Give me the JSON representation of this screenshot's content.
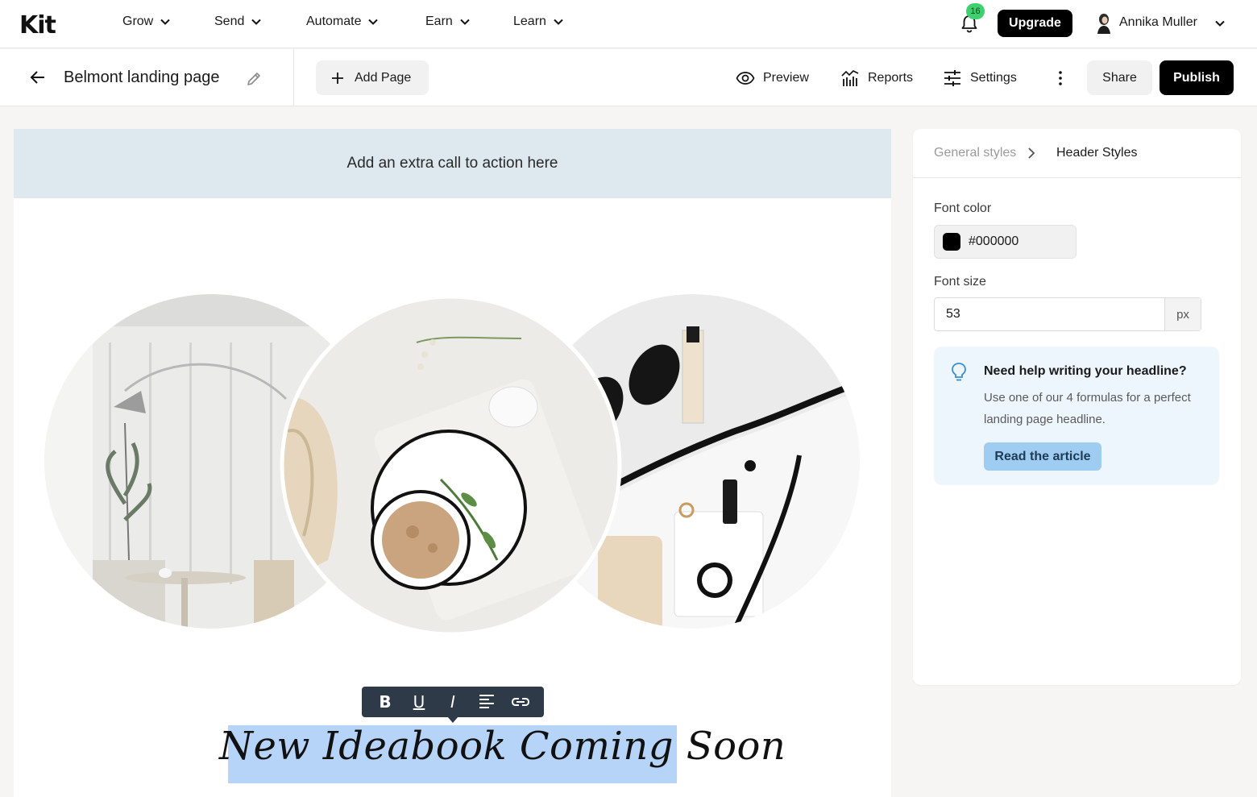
{
  "nav": {
    "logo": "Kit",
    "items": [
      {
        "label": "Grow"
      },
      {
        "label": "Send"
      },
      {
        "label": "Automate"
      },
      {
        "label": "Earn"
      },
      {
        "label": "Learn"
      }
    ],
    "notification_count": "16",
    "upgrade_label": "Upgrade",
    "user_name": "Annika Muller"
  },
  "toolbar": {
    "page_title": "Belmont landing page",
    "add_page_label": "Add Page",
    "preview_label": "Preview",
    "reports_label": "Reports",
    "settings_label": "Settings",
    "share_label": "Share",
    "publish_label": "Publish"
  },
  "canvas": {
    "cta_text": "Add an extra call to action here",
    "headline": "New Ideabook Coming Soon",
    "format_toolbar": [
      "B",
      "U",
      "I",
      "align",
      "link"
    ]
  },
  "panel": {
    "crumb_general": "General styles",
    "crumb_current": "Header Styles",
    "font_color_label": "Font color",
    "font_color_value": "#000000",
    "font_size_label": "Font size",
    "font_size_value": "53",
    "font_size_unit": "px",
    "help_title": "Need help writing your headline?",
    "help_text": "Use one of our 4 formulas for a perfect landing page headline.",
    "help_button": "Read the article"
  },
  "colors": {
    "accent_dark": "#000000",
    "cta_background": "#dde9ee",
    "selection_highlight": "#b6d3f8",
    "help_background": "#eef6fd",
    "help_button": "#9fcdf2",
    "badge_green": "#3ecf6e"
  }
}
